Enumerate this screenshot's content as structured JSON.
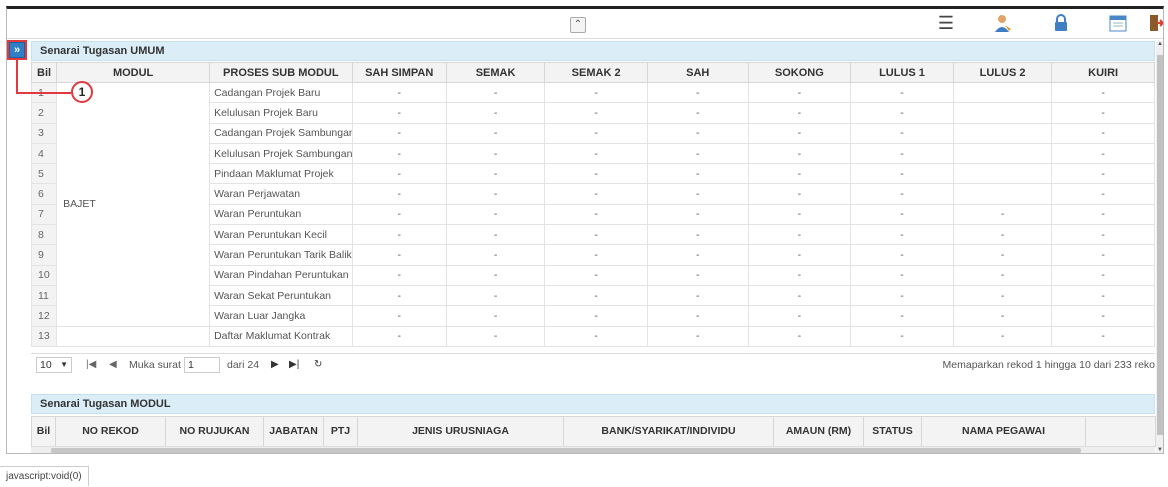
{
  "topbar": {
    "collapse_icon": "double-chevron-up-icon",
    "icons": [
      "menu-icon",
      "user-icon",
      "lock-icon",
      "calendar-icon",
      "exit-icon"
    ]
  },
  "side_expand": {
    "label": "»"
  },
  "callout": {
    "number": "1"
  },
  "panel1": {
    "title": "Senarai Tugasan UMUM",
    "columns": [
      "Bil",
      "MODUL",
      "PROSES SUB MODUL",
      "SAH SIMPAN",
      "SEMAK",
      "SEMAK 2",
      "SAH",
      "SOKONG",
      "LULUS 1",
      "LULUS 2",
      "KUIRI"
    ],
    "modul_group": "BAJET",
    "rows": [
      {
        "bil": "1",
        "proses": "Cadangan Projek Baru",
        "vals": [
          "-",
          "-",
          "-",
          "-",
          "-",
          "-",
          "",
          "-"
        ]
      },
      {
        "bil": "2",
        "proses": "Kelulusan Projek Baru",
        "vals": [
          "-",
          "-",
          "-",
          "-",
          "-",
          "-",
          "",
          "-"
        ]
      },
      {
        "bil": "3",
        "proses": "Cadangan Projek Sambungan",
        "vals": [
          "-",
          "-",
          "-",
          "-",
          "-",
          "-",
          "",
          "-"
        ]
      },
      {
        "bil": "4",
        "proses": "Kelulusan Projek Sambungan",
        "vals": [
          "-",
          "-",
          "-",
          "-",
          "-",
          "-",
          "",
          "-"
        ]
      },
      {
        "bil": "5",
        "proses": "Pindaan Maklumat Projek",
        "vals": [
          "-",
          "-",
          "-",
          "-",
          "-",
          "-",
          "",
          "-"
        ]
      },
      {
        "bil": "6",
        "proses": "Waran Perjawatan",
        "vals": [
          "-",
          "-",
          "-",
          "-",
          "-",
          "-",
          "",
          "-"
        ]
      },
      {
        "bil": "7",
        "proses": "Waran Peruntukan",
        "vals": [
          "-",
          "-",
          "-",
          "-",
          "-",
          "-",
          "-",
          "-"
        ]
      },
      {
        "bil": "8",
        "proses": "Waran Peruntukan Kecil",
        "vals": [
          "-",
          "-",
          "-",
          "-",
          "-",
          "-",
          "-",
          "-"
        ]
      },
      {
        "bil": "9",
        "proses": "Waran Peruntukan Tarik Balik",
        "vals": [
          "-",
          "-",
          "-",
          "-",
          "-",
          "-",
          "-",
          "-"
        ]
      },
      {
        "bil": "10",
        "proses": "Waran Pindahan Peruntukan",
        "vals": [
          "-",
          "-",
          "-",
          "-",
          "-",
          "-",
          "-",
          "-"
        ]
      },
      {
        "bil": "11",
        "proses": "Waran Sekat Peruntukan",
        "vals": [
          "-",
          "-",
          "-",
          "-",
          "-",
          "-",
          "-",
          "-"
        ]
      },
      {
        "bil": "12",
        "proses": "Waran Luar Jangka",
        "vals": [
          "-",
          "-",
          "-",
          "-",
          "-",
          "-",
          "-",
          "-"
        ]
      },
      {
        "bil": "13",
        "proses": "Daftar Maklumat Kontrak",
        "vals": [
          "-",
          "-",
          "-",
          "-",
          "-",
          "-",
          "-",
          "-"
        ]
      }
    ]
  },
  "pager": {
    "page_size": "10",
    "page_label": "Muka surat",
    "page_value": "1",
    "of_label": "dari 24",
    "info": "Memaparkan rekod 1 hingga 10 dari 233 reko"
  },
  "panel2": {
    "title": "Senarai Tugasan MODUL",
    "columns": [
      "Bil",
      "NO REKOD",
      "NO RUJUKAN",
      "JABATAN",
      "PTJ",
      "JENIS URUSNIAGA",
      "BANK/SYARIKAT/INDIVIDU",
      "AMAUN (RM)",
      "STATUS",
      "NAMA PEGAWAI",
      ""
    ]
  },
  "statusbar": {
    "text": "javascript:void(0)"
  }
}
